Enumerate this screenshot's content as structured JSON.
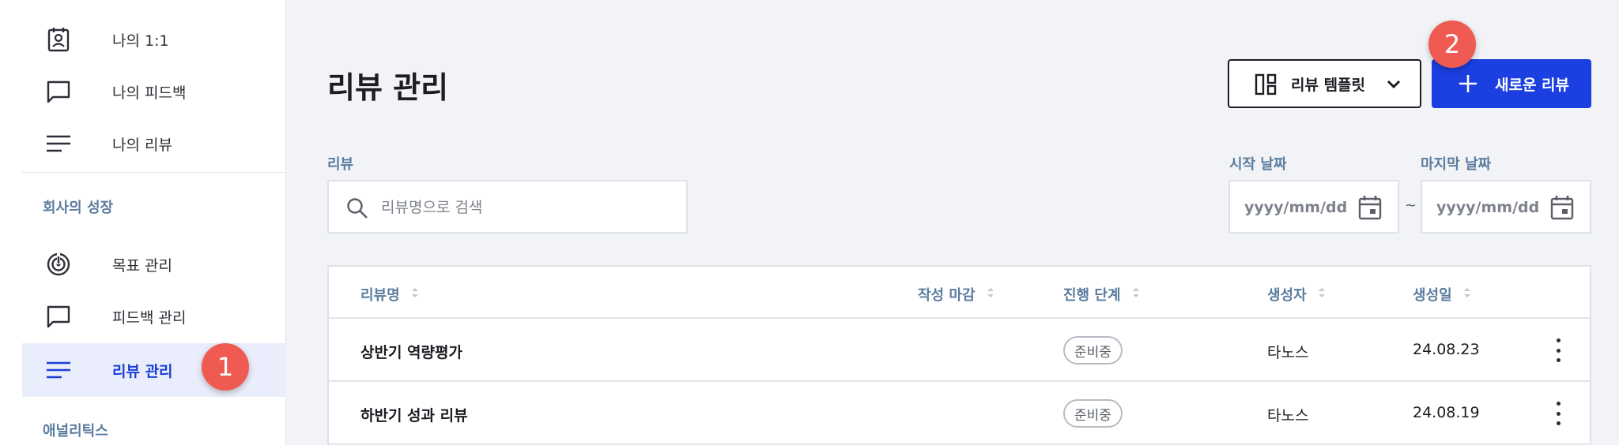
{
  "sidebar": {
    "items": [
      {
        "label": "나의 1:1",
        "icon": "profile-card-icon"
      },
      {
        "label": "나의 피드백",
        "icon": "chat-bubble-icon"
      },
      {
        "label": "나의 리뷰",
        "icon": "lines-icon"
      }
    ],
    "section_company": "회사의 성장",
    "company_items": [
      {
        "label": "목표 관리",
        "icon": "target-icon"
      },
      {
        "label": "피드백 관리",
        "icon": "chat-bubble-icon"
      },
      {
        "label": "리뷰 관리",
        "icon": "lines-icon",
        "active": true
      }
    ],
    "section_analytics": "애널리틱스"
  },
  "markers": {
    "one": "1",
    "two": "2"
  },
  "header": {
    "title": "리뷰 관리",
    "template_button": "리뷰 템플릿",
    "new_button": "새로운 리뷰"
  },
  "filters": {
    "review_label": "리뷰",
    "search_placeholder": "리뷰명으로 검색",
    "start_label": "시작 날짜",
    "end_label": "마지막 날짜",
    "date_placeholder": "yyyy/mm/dd",
    "range_separator": "~"
  },
  "table": {
    "columns": [
      "리뷰명",
      "작성 마감",
      "진행 단계",
      "생성자",
      "생성일"
    ],
    "rows": [
      {
        "name": "상반기 역량평가",
        "deadline": "",
        "stage": "준비중",
        "creator": "타노스",
        "created": "24.08.23"
      },
      {
        "name": "하반기 성과 리뷰",
        "deadline": "",
        "stage": "준비중",
        "creator": "타노스",
        "created": "24.08.19"
      }
    ]
  },
  "colors": {
    "accent": "#1b3fe0",
    "label": "#5a7c9e",
    "marker": "#ef5b52"
  }
}
